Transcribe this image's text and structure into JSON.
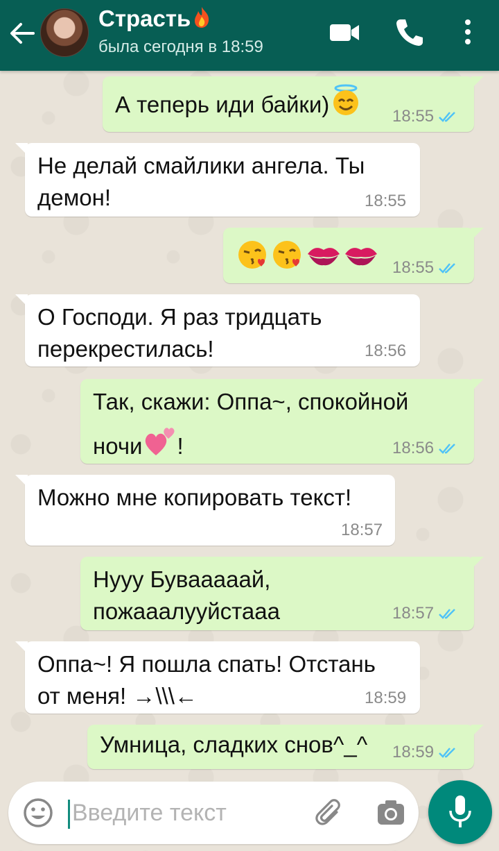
{
  "header": {
    "contact_name": "Страсть",
    "last_seen": "была сегодня в 18:59"
  },
  "messages": [
    {
      "direction": "out",
      "text": "А теперь иди байки)",
      "emoji": "smiling-face-with-halo",
      "time": "18:55",
      "status": "read"
    },
    {
      "direction": "in",
      "line1": "Не делай смайлики ангела. Ты",
      "line2": "демон!",
      "time": "18:55"
    },
    {
      "direction": "out",
      "emoji": [
        "face-blowing-kiss",
        "face-blowing-kiss",
        "kiss-mark",
        "kiss-mark"
      ],
      "time": "18:55",
      "status": "read"
    },
    {
      "direction": "in",
      "line1": "О Господи. Я раз тридцать",
      "line2": "перекрестилась!",
      "time": "18:56"
    },
    {
      "direction": "out",
      "line1": "Так, скажи: Оппа~, спокойной",
      "line2_before": "ночи",
      "line2_emoji": "two-hearts",
      "line2_after": "!",
      "time": "18:56",
      "status": "read"
    },
    {
      "direction": "in",
      "text": "Можно мне копировать текст!",
      "time": "18:57"
    },
    {
      "direction": "out",
      "line1": "Нууу Бувааааай,",
      "line2": "пожааалууйстааа",
      "time": "18:57",
      "status": "read"
    },
    {
      "direction": "in",
      "line1": "Оппа~! Я пошла спать! Отстань",
      "line2": "от меня! →\\\\\\←",
      "time": "18:59"
    },
    {
      "direction": "out",
      "text": "Умница, сладких снов^_^",
      "time": "18:59",
      "status": "read"
    }
  ],
  "input": {
    "placeholder": "Введите текст"
  },
  "colors": {
    "header": "#075e54",
    "outgoing_bubble": "#dcf8c6",
    "incoming_bubble": "#ffffff",
    "read_ticks": "#4fc3f7",
    "mic_button": "#00897b"
  }
}
